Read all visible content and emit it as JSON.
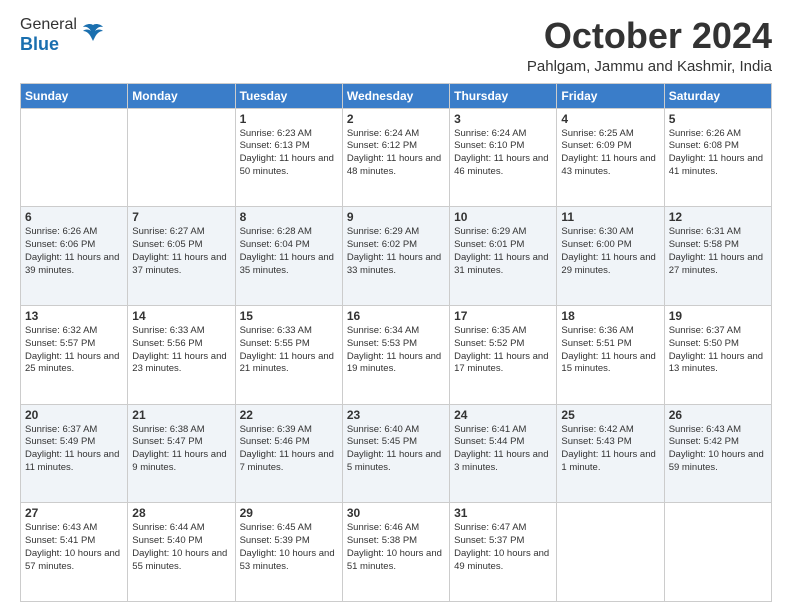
{
  "logo": {
    "general": "General",
    "blue": "Blue"
  },
  "title": "October 2024",
  "location": "Pahlgam, Jammu and Kashmir, India",
  "days_of_week": [
    "Sunday",
    "Monday",
    "Tuesday",
    "Wednesday",
    "Thursday",
    "Friday",
    "Saturday"
  ],
  "weeks": [
    [
      {
        "day": "",
        "sunrise": "",
        "sunset": "",
        "daylight": ""
      },
      {
        "day": "",
        "sunrise": "",
        "sunset": "",
        "daylight": ""
      },
      {
        "day": "1",
        "sunrise": "Sunrise: 6:23 AM",
        "sunset": "Sunset: 6:13 PM",
        "daylight": "Daylight: 11 hours and 50 minutes."
      },
      {
        "day": "2",
        "sunrise": "Sunrise: 6:24 AM",
        "sunset": "Sunset: 6:12 PM",
        "daylight": "Daylight: 11 hours and 48 minutes."
      },
      {
        "day": "3",
        "sunrise": "Sunrise: 6:24 AM",
        "sunset": "Sunset: 6:10 PM",
        "daylight": "Daylight: 11 hours and 46 minutes."
      },
      {
        "day": "4",
        "sunrise": "Sunrise: 6:25 AM",
        "sunset": "Sunset: 6:09 PM",
        "daylight": "Daylight: 11 hours and 43 minutes."
      },
      {
        "day": "5",
        "sunrise": "Sunrise: 6:26 AM",
        "sunset": "Sunset: 6:08 PM",
        "daylight": "Daylight: 11 hours and 41 minutes."
      }
    ],
    [
      {
        "day": "6",
        "sunrise": "Sunrise: 6:26 AM",
        "sunset": "Sunset: 6:06 PM",
        "daylight": "Daylight: 11 hours and 39 minutes."
      },
      {
        "day": "7",
        "sunrise": "Sunrise: 6:27 AM",
        "sunset": "Sunset: 6:05 PM",
        "daylight": "Daylight: 11 hours and 37 minutes."
      },
      {
        "day": "8",
        "sunrise": "Sunrise: 6:28 AM",
        "sunset": "Sunset: 6:04 PM",
        "daylight": "Daylight: 11 hours and 35 minutes."
      },
      {
        "day": "9",
        "sunrise": "Sunrise: 6:29 AM",
        "sunset": "Sunset: 6:02 PM",
        "daylight": "Daylight: 11 hours and 33 minutes."
      },
      {
        "day": "10",
        "sunrise": "Sunrise: 6:29 AM",
        "sunset": "Sunset: 6:01 PM",
        "daylight": "Daylight: 11 hours and 31 minutes."
      },
      {
        "day": "11",
        "sunrise": "Sunrise: 6:30 AM",
        "sunset": "Sunset: 6:00 PM",
        "daylight": "Daylight: 11 hours and 29 minutes."
      },
      {
        "day": "12",
        "sunrise": "Sunrise: 6:31 AM",
        "sunset": "Sunset: 5:58 PM",
        "daylight": "Daylight: 11 hours and 27 minutes."
      }
    ],
    [
      {
        "day": "13",
        "sunrise": "Sunrise: 6:32 AM",
        "sunset": "Sunset: 5:57 PM",
        "daylight": "Daylight: 11 hours and 25 minutes."
      },
      {
        "day": "14",
        "sunrise": "Sunrise: 6:33 AM",
        "sunset": "Sunset: 5:56 PM",
        "daylight": "Daylight: 11 hours and 23 minutes."
      },
      {
        "day": "15",
        "sunrise": "Sunrise: 6:33 AM",
        "sunset": "Sunset: 5:55 PM",
        "daylight": "Daylight: 11 hours and 21 minutes."
      },
      {
        "day": "16",
        "sunrise": "Sunrise: 6:34 AM",
        "sunset": "Sunset: 5:53 PM",
        "daylight": "Daylight: 11 hours and 19 minutes."
      },
      {
        "day": "17",
        "sunrise": "Sunrise: 6:35 AM",
        "sunset": "Sunset: 5:52 PM",
        "daylight": "Daylight: 11 hours and 17 minutes."
      },
      {
        "day": "18",
        "sunrise": "Sunrise: 6:36 AM",
        "sunset": "Sunset: 5:51 PM",
        "daylight": "Daylight: 11 hours and 15 minutes."
      },
      {
        "day": "19",
        "sunrise": "Sunrise: 6:37 AM",
        "sunset": "Sunset: 5:50 PM",
        "daylight": "Daylight: 11 hours and 13 minutes."
      }
    ],
    [
      {
        "day": "20",
        "sunrise": "Sunrise: 6:37 AM",
        "sunset": "Sunset: 5:49 PM",
        "daylight": "Daylight: 11 hours and 11 minutes."
      },
      {
        "day": "21",
        "sunrise": "Sunrise: 6:38 AM",
        "sunset": "Sunset: 5:47 PM",
        "daylight": "Daylight: 11 hours and 9 minutes."
      },
      {
        "day": "22",
        "sunrise": "Sunrise: 6:39 AM",
        "sunset": "Sunset: 5:46 PM",
        "daylight": "Daylight: 11 hours and 7 minutes."
      },
      {
        "day": "23",
        "sunrise": "Sunrise: 6:40 AM",
        "sunset": "Sunset: 5:45 PM",
        "daylight": "Daylight: 11 hours and 5 minutes."
      },
      {
        "day": "24",
        "sunrise": "Sunrise: 6:41 AM",
        "sunset": "Sunset: 5:44 PM",
        "daylight": "Daylight: 11 hours and 3 minutes."
      },
      {
        "day": "25",
        "sunrise": "Sunrise: 6:42 AM",
        "sunset": "Sunset: 5:43 PM",
        "daylight": "Daylight: 11 hours and 1 minute."
      },
      {
        "day": "26",
        "sunrise": "Sunrise: 6:43 AM",
        "sunset": "Sunset: 5:42 PM",
        "daylight": "Daylight: 10 hours and 59 minutes."
      }
    ],
    [
      {
        "day": "27",
        "sunrise": "Sunrise: 6:43 AM",
        "sunset": "Sunset: 5:41 PM",
        "daylight": "Daylight: 10 hours and 57 minutes."
      },
      {
        "day": "28",
        "sunrise": "Sunrise: 6:44 AM",
        "sunset": "Sunset: 5:40 PM",
        "daylight": "Daylight: 10 hours and 55 minutes."
      },
      {
        "day": "29",
        "sunrise": "Sunrise: 6:45 AM",
        "sunset": "Sunset: 5:39 PM",
        "daylight": "Daylight: 10 hours and 53 minutes."
      },
      {
        "day": "30",
        "sunrise": "Sunrise: 6:46 AM",
        "sunset": "Sunset: 5:38 PM",
        "daylight": "Daylight: 10 hours and 51 minutes."
      },
      {
        "day": "31",
        "sunrise": "Sunrise: 6:47 AM",
        "sunset": "Sunset: 5:37 PM",
        "daylight": "Daylight: 10 hours and 49 minutes."
      },
      {
        "day": "",
        "sunrise": "",
        "sunset": "",
        "daylight": ""
      },
      {
        "day": "",
        "sunrise": "",
        "sunset": "",
        "daylight": ""
      }
    ]
  ]
}
